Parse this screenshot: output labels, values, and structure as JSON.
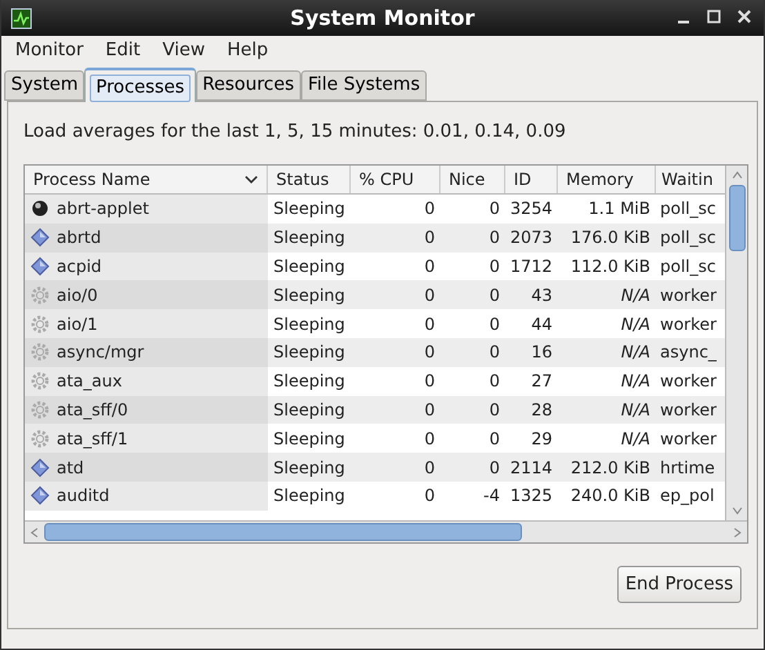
{
  "window": {
    "title": "System Monitor"
  },
  "menu": [
    "Monitor",
    "Edit",
    "View",
    "Help"
  ],
  "tabs": [
    {
      "label": "System",
      "selected": false
    },
    {
      "label": "Processes",
      "selected": true
    },
    {
      "label": "Resources",
      "selected": false
    },
    {
      "label": "File Systems",
      "selected": false
    }
  ],
  "load_averages": "Load averages for the last 1, 5, 15 minutes: 0.01, 0.14, 0.09",
  "table": {
    "columns": [
      {
        "label": "Process Name",
        "sorted": true
      },
      {
        "label": "Status",
        "sorted": false
      },
      {
        "label": "% CPU",
        "sorted": false
      },
      {
        "label": "Nice",
        "sorted": false
      },
      {
        "label": "ID",
        "sorted": false
      },
      {
        "label": "Memory",
        "sorted": false
      },
      {
        "label": "Waitin",
        "sorted": false
      }
    ],
    "rows": [
      {
        "kind": "applet",
        "cells": [
          "abrt-applet",
          "Sleeping",
          "0",
          "0",
          "3254",
          "1.1 MiB",
          "poll_sc"
        ]
      },
      {
        "kind": "daemon",
        "cells": [
          "abrtd",
          "Sleeping",
          "0",
          "0",
          "2073",
          "176.0 KiB",
          "poll_sc"
        ]
      },
      {
        "kind": "daemon",
        "cells": [
          "acpid",
          "Sleeping",
          "0",
          "0",
          "1712",
          "112.0 KiB",
          "poll_sc"
        ]
      },
      {
        "kind": "kernel",
        "cells": [
          "aio/0",
          "Sleeping",
          "0",
          "0",
          "43",
          "N/A",
          "worker"
        ]
      },
      {
        "kind": "kernel",
        "cells": [
          "aio/1",
          "Sleeping",
          "0",
          "0",
          "44",
          "N/A",
          "worker"
        ]
      },
      {
        "kind": "kernel",
        "cells": [
          "async/mgr",
          "Sleeping",
          "0",
          "0",
          "16",
          "N/A",
          "async_"
        ]
      },
      {
        "kind": "kernel",
        "cells": [
          "ata_aux",
          "Sleeping",
          "0",
          "0",
          "27",
          "N/A",
          "worker"
        ]
      },
      {
        "kind": "kernel",
        "cells": [
          "ata_sff/0",
          "Sleeping",
          "0",
          "0",
          "28",
          "N/A",
          "worker"
        ]
      },
      {
        "kind": "kernel",
        "cells": [
          "ata_sff/1",
          "Sleeping",
          "0",
          "0",
          "29",
          "N/A",
          "worker"
        ]
      },
      {
        "kind": "daemon",
        "cells": [
          "atd",
          "Sleeping",
          "0",
          "0",
          "2114",
          "212.0 KiB",
          "hrtime"
        ]
      },
      {
        "kind": "daemon",
        "cells": [
          "auditd",
          "Sleeping",
          "0",
          "-4",
          "1325",
          "240.0 KiB",
          "ep_pol"
        ]
      }
    ]
  },
  "buttons": [
    "End Process"
  ]
}
